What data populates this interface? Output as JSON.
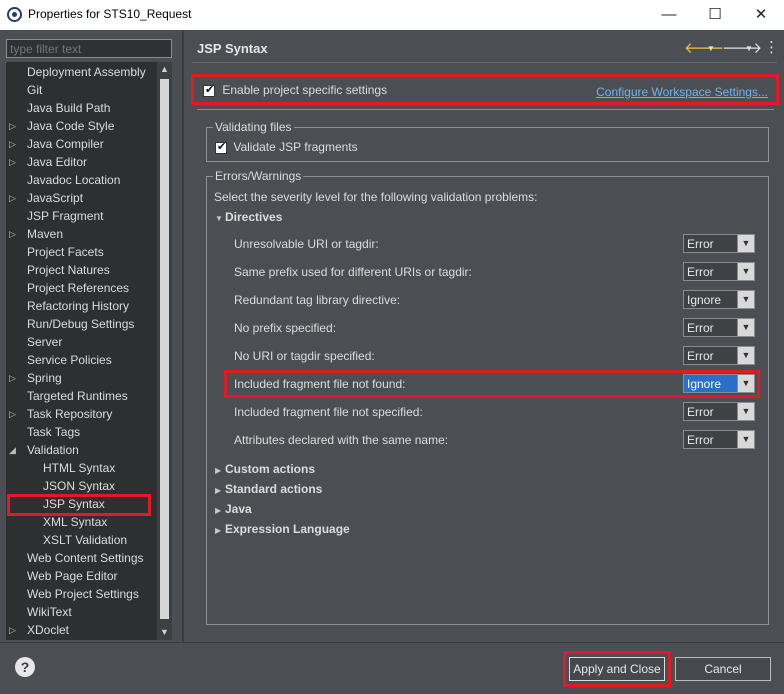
{
  "window": {
    "title": "Properties for STS10_Request",
    "minimize_glyph": "—",
    "maximize_glyph": "☐",
    "close_glyph": "✕"
  },
  "sidebar": {
    "filter_placeholder": "type filter text",
    "items": [
      {
        "label": "Deployment Assembly",
        "expandable": false
      },
      {
        "label": "Git",
        "expandable": false
      },
      {
        "label": "Java Build Path",
        "expandable": false
      },
      {
        "label": "Java Code Style",
        "expandable": true
      },
      {
        "label": "Java Compiler",
        "expandable": true
      },
      {
        "label": "Java Editor",
        "expandable": true
      },
      {
        "label": "Javadoc Location",
        "expandable": false
      },
      {
        "label": "JavaScript",
        "expandable": true
      },
      {
        "label": "JSP Fragment",
        "expandable": false
      },
      {
        "label": "Maven",
        "expandable": true
      },
      {
        "label": "Project Facets",
        "expandable": false
      },
      {
        "label": "Project Natures",
        "expandable": false
      },
      {
        "label": "Project References",
        "expandable": false
      },
      {
        "label": "Refactoring History",
        "expandable": false
      },
      {
        "label": "Run/Debug Settings",
        "expandable": false
      },
      {
        "label": "Server",
        "expandable": false
      },
      {
        "label": "Service Policies",
        "expandable": false
      },
      {
        "label": "Spring",
        "expandable": true
      },
      {
        "label": "Targeted Runtimes",
        "expandable": false
      },
      {
        "label": "Task Repository",
        "expandable": true
      },
      {
        "label": "Task Tags",
        "expandable": false
      },
      {
        "label": "Validation",
        "expandable": true,
        "expanded": true
      },
      {
        "label": "HTML Syntax",
        "child": true
      },
      {
        "label": "JSON Syntax",
        "child": true
      },
      {
        "label": "JSP Syntax",
        "child": true,
        "selected": true
      },
      {
        "label": "XML Syntax",
        "child": true
      },
      {
        "label": "XSLT Validation",
        "child": true
      },
      {
        "label": "Web Content Settings",
        "expandable": false
      },
      {
        "label": "Web Page Editor",
        "expandable": false
      },
      {
        "label": "Web Project Settings",
        "expandable": false
      },
      {
        "label": "WikiText",
        "expandable": false
      },
      {
        "label": "XDoclet",
        "expandable": true
      }
    ]
  },
  "header": {
    "title": "JSP Syntax"
  },
  "main": {
    "enable_label": "Enable project specific settings",
    "enable_checked": true,
    "configure_link": "Configure Workspace Settings...",
    "validating_files": {
      "legend": "Validating files",
      "validate_label": "Validate JSP fragments",
      "validate_checked": true
    },
    "errors_warnings": {
      "legend": "Errors/Warnings",
      "intro": "Select the severity level for the following validation problems:",
      "directives_label": "Directives",
      "rows": [
        {
          "label": "Unresolvable URI or tagdir:",
          "value": "Error"
        },
        {
          "label": "Same prefix used for different URIs or tagdir:",
          "value": "Error"
        },
        {
          "label": "Redundant tag library directive:",
          "value": "Ignore"
        },
        {
          "label": "No prefix specified:",
          "value": "Error"
        },
        {
          "label": "No URI or tagdir specified:",
          "value": "Error"
        },
        {
          "label": "Included fragment file not found:",
          "value": "Ignore",
          "highlighted": true
        },
        {
          "label": "Included fragment file not specified:",
          "value": "Error"
        },
        {
          "label": "Attributes declared with the same name:",
          "value": "Error"
        }
      ],
      "sections": [
        "Custom actions",
        "Standard actions",
        "Java",
        "Expression Language"
      ]
    }
  },
  "footer": {
    "help": "?",
    "apply_close": "Apply and Close",
    "cancel": "Cancel"
  },
  "colors": {
    "highlight": "#e01b24",
    "link": "#6fb3ef",
    "background": "#4b4f53",
    "selection": "#2a6ec8"
  }
}
